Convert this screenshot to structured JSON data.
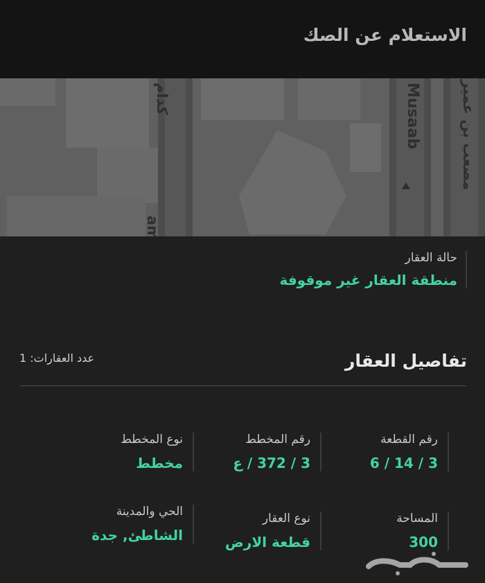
{
  "header": {
    "title": "الاستعلام عن الصك"
  },
  "map": {
    "street_labels": [
      "كدام",
      "am",
      "Musaab",
      "مصعب بن عمير"
    ]
  },
  "status": {
    "label": "حالة العقار",
    "value": "منطقة العقار غير موقوفة"
  },
  "details": {
    "title": "تفاصيل العقار",
    "count_label": "عدد العقارات: 1",
    "fields": [
      {
        "label": "رقم القطعة",
        "value": "3 / 14 / 6"
      },
      {
        "label": "رقم المخطط",
        "value": "3 / 372 / ع"
      },
      {
        "label": "نوع المخطط",
        "value": "مخطط"
      },
      {
        "label": "المساحة",
        "value": "300"
      },
      {
        "label": "نوع العقار",
        "value": "قطعة الارض"
      },
      {
        "label": "الحي والمدينة",
        "value": "الشاطئ, جدة"
      }
    ]
  },
  "watermark": {
    "text": "حراج"
  },
  "colors": {
    "accent": "#42d3a1",
    "background": "#1f1f1f",
    "header": "#141414"
  }
}
